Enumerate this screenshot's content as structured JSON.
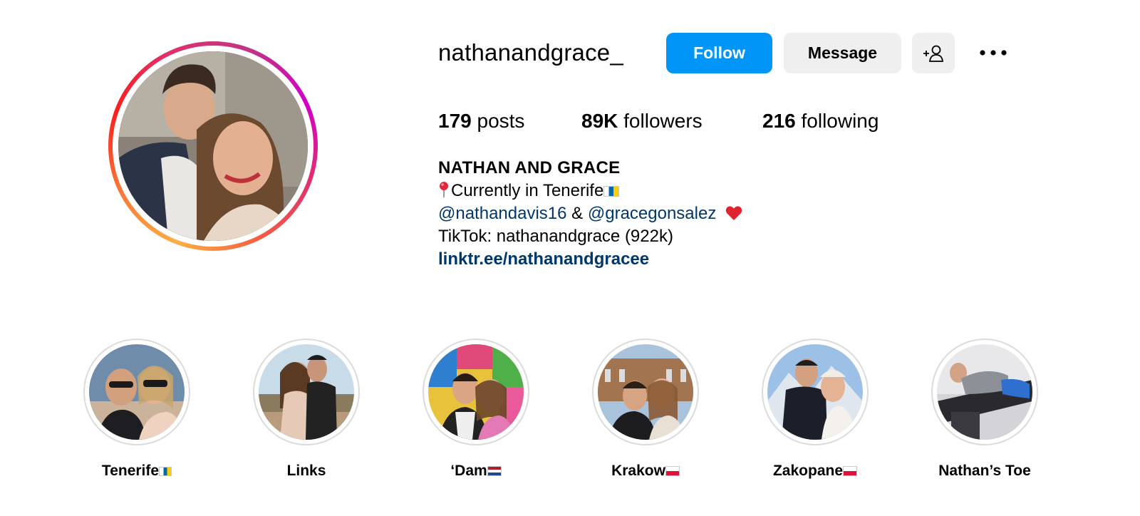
{
  "profile": {
    "username": "nathanandgrace_",
    "follow_label": "Follow",
    "message_label": "Message",
    "add_user_icon": "person-add-icon",
    "more_icon": "more-options-icon"
  },
  "stats": {
    "posts_count": "179",
    "posts_label": "posts",
    "followers_count": "89K",
    "followers_label": "followers",
    "following_count": "216",
    "following_label": "following"
  },
  "bio": {
    "name": "NATHAN AND GRACE",
    "location_text": "Currently in Tenerife",
    "mention_1": "@nathandavis16",
    "ampersand": "&",
    "mention_2": "@gracegonsalez",
    "tiktok": "TikTok: nathanandgrace (922k)",
    "link": "linktr.ee/nathanandgracee"
  },
  "highlights": [
    {
      "label": "Tenerife",
      "flag": "canary-islands-flag"
    },
    {
      "label": "Links"
    },
    {
      "label": "‘Dam",
      "flag": "netherlands-flag"
    },
    {
      "label": "Krakow",
      "flag": "poland-flag"
    },
    {
      "label": "Zakopane",
      "flag": "poland-flag"
    },
    {
      "label": "Nathan’s Toe"
    }
  ],
  "colors": {
    "follow_blue": "#0095f6",
    "secondary_button_bg": "#efefef",
    "link_blue": "#00376b",
    "story_ring": "instagram-gradient"
  }
}
